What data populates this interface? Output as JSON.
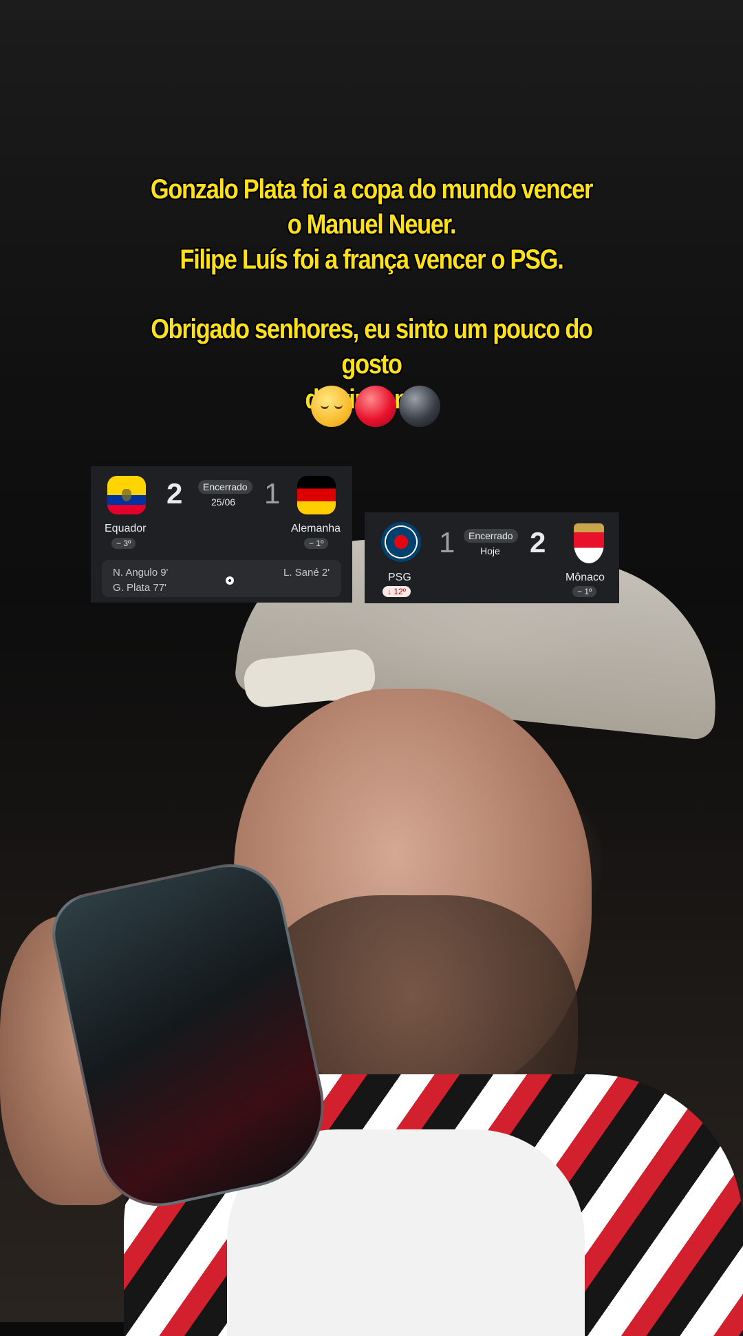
{
  "caption": {
    "line1": "Gonzalo Plata foi a copa do mundo vencer",
    "line2": "o Manuel Neuer.",
    "line3": "Filipe Luís foi a frança vencer o PSG.",
    "line4": "Obrigado senhores, eu sinto um pouco do gosto",
    "line5": "da vingança.",
    "emojis": [
      "relieved-face",
      "red-circle",
      "black-circle"
    ]
  },
  "match1": {
    "home_team": "Equador",
    "home_rank": "− 3º",
    "home_score": "2",
    "away_team": "Alemanha",
    "away_rank": "− 1º",
    "away_score": "1",
    "status": "Encerrado",
    "date": "25/06",
    "home_scorers": [
      "N. Angulo 9'",
      "G. Plata 77'"
    ],
    "away_scorers": [
      "L. Sané 2'"
    ]
  },
  "match2": {
    "home_team": "PSG",
    "home_rank": "↓ 12º",
    "home_score": "1",
    "away_team": "Mônaco",
    "away_rank": "− 1º",
    "away_score": "2",
    "status": "Encerrado",
    "date": "Hoje"
  },
  "colors": {
    "caption_yellow": "#ffe11a",
    "card_bg": "#1f2023",
    "rank_down_bg": "#fce8e6"
  }
}
